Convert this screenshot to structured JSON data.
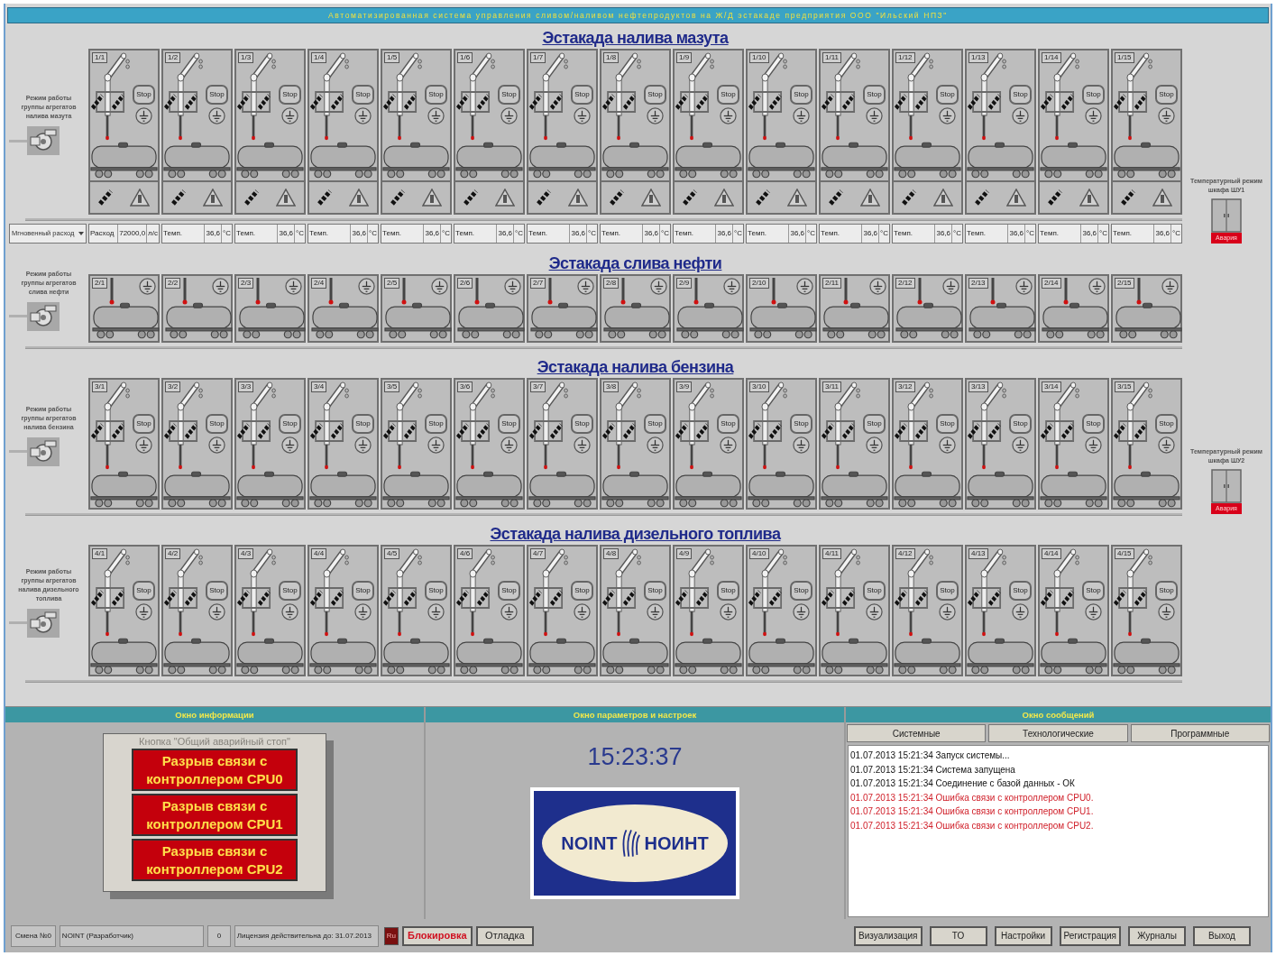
{
  "window": {
    "title": "Автоматизированная система управления сливом/наливом нефтепродуктов на Ж/Д эстакаде предприятия ООО \"Ильский НПЗ\""
  },
  "sections": [
    {
      "title": "Эстакада налива мазута",
      "kind": "loading_valves",
      "group_label": "Режим работы группы агрегатов налива мазута",
      "flow_selector": "Мгновенный расход",
      "bays": [
        {
          "label": "1/1",
          "sign": "Stop"
        },
        {
          "label": "1/2",
          "sign": "Stop"
        },
        {
          "label": "1/3",
          "sign": "Stop"
        },
        {
          "label": "1/4",
          "sign": "Stop"
        },
        {
          "label": "1/5",
          "sign": "Stop"
        },
        {
          "label": "1/6",
          "sign": "Stop"
        },
        {
          "label": "1/7",
          "sign": "Stop"
        },
        {
          "label": "1/8",
          "sign": "Stop"
        },
        {
          "label": "1/9",
          "sign": "Stop"
        },
        {
          "label": "1/10",
          "sign": "Stop"
        },
        {
          "label": "1/11",
          "sign": "Stop"
        },
        {
          "label": "1/12",
          "sign": "Stop"
        },
        {
          "label": "1/13",
          "sign": "Stop"
        },
        {
          "label": "1/14",
          "sign": "Stop"
        },
        {
          "label": "1/15",
          "sign": "Stop"
        }
      ],
      "readings": [
        {
          "name": "Расход",
          "value": "72000,0",
          "unit": "л/с"
        },
        {
          "name": "Темп.",
          "value": "36,6",
          "unit": "°C"
        },
        {
          "name": "Темп.",
          "value": "36,6",
          "unit": "°C"
        },
        {
          "name": "Темп.",
          "value": "36,6",
          "unit": "°C"
        },
        {
          "name": "Темп.",
          "value": "36,6",
          "unit": "°C"
        },
        {
          "name": "Темп.",
          "value": "36,6",
          "unit": "°C"
        },
        {
          "name": "Темп.",
          "value": "36,6",
          "unit": "°C"
        },
        {
          "name": "Темп.",
          "value": "36,6",
          "unit": "°C"
        },
        {
          "name": "Темп.",
          "value": "36,6",
          "unit": "°C"
        },
        {
          "name": "Темп.",
          "value": "36,6",
          "unit": "°C"
        },
        {
          "name": "Темп.",
          "value": "36,6",
          "unit": "°C"
        },
        {
          "name": "Темп.",
          "value": "36,6",
          "unit": "°C"
        },
        {
          "name": "Темп.",
          "value": "36,6",
          "unit": "°C"
        },
        {
          "name": "Темп.",
          "value": "36,6",
          "unit": "°C"
        },
        {
          "name": "Темп.",
          "value": "36,6",
          "unit": "°C"
        }
      ],
      "cabinet": {
        "label": "Температурный режим шкафа ШУ1",
        "alarm": "Авария"
      }
    },
    {
      "title": "Эстакада слива нефти",
      "kind": "drain",
      "group_label": "Режим работы группы агрегатов слива нефти",
      "bays": [
        {
          "label": "2/1"
        },
        {
          "label": "2/2"
        },
        {
          "label": "2/3"
        },
        {
          "label": "2/4"
        },
        {
          "label": "2/5"
        },
        {
          "label": "2/6"
        },
        {
          "label": "2/7"
        },
        {
          "label": "2/8"
        },
        {
          "label": "2/9"
        },
        {
          "label": "2/10"
        },
        {
          "label": "2/11"
        },
        {
          "label": "2/12"
        },
        {
          "label": "2/13"
        },
        {
          "label": "2/14"
        },
        {
          "label": "2/15"
        }
      ]
    },
    {
      "title": "Эстакада налива бензина",
      "kind": "loading",
      "group_label": "Режим работы группы агрегатов налива бензина",
      "bays": [
        {
          "label": "3/1",
          "sign": "Stop"
        },
        {
          "label": "3/2",
          "sign": "Stop"
        },
        {
          "label": "3/3",
          "sign": "Stop"
        },
        {
          "label": "3/4",
          "sign": "Stop"
        },
        {
          "label": "3/5",
          "sign": "Stop"
        },
        {
          "label": "3/6",
          "sign": "Stop"
        },
        {
          "label": "3/7",
          "sign": "Stop"
        },
        {
          "label": "3/8",
          "sign": "Stop"
        },
        {
          "label": "3/9",
          "sign": "Stop"
        },
        {
          "label": "3/10",
          "sign": "Stop"
        },
        {
          "label": "3/11",
          "sign": "Stop"
        },
        {
          "label": "3/12",
          "sign": "Stop"
        },
        {
          "label": "3/13",
          "sign": "Stop"
        },
        {
          "label": "3/14",
          "sign": "Stop"
        },
        {
          "label": "3/15",
          "sign": "Stop"
        }
      ],
      "cabinet": {
        "label": "Температурный режим шкафа ШУ2",
        "alarm": "Авария"
      }
    },
    {
      "title": "Эстакада налива дизельного топлива",
      "kind": "loading",
      "group_label": "Режим работы группы агрегатов налива дизельного топлива",
      "bays": [
        {
          "label": "4/1",
          "sign": "Stop"
        },
        {
          "label": "4/2",
          "sign": "Stop"
        },
        {
          "label": "4/3",
          "sign": "Stop"
        },
        {
          "label": "4/4",
          "sign": "Stop"
        },
        {
          "label": "4/5",
          "sign": "Stop"
        },
        {
          "label": "4/6",
          "sign": "Stop"
        },
        {
          "label": "4/7",
          "sign": "Stop"
        },
        {
          "label": "4/8",
          "sign": "Stop"
        },
        {
          "label": "4/9",
          "sign": "Stop"
        },
        {
          "label": "4/10",
          "sign": "Stop"
        },
        {
          "label": "4/11",
          "sign": "Stop"
        },
        {
          "label": "4/12",
          "sign": "Stop"
        },
        {
          "label": "4/13",
          "sign": "Stop"
        },
        {
          "label": "4/14",
          "sign": "Stop"
        },
        {
          "label": "4/15",
          "sign": "Stop"
        }
      ]
    }
  ],
  "info_panel": {
    "title": "Окно информации",
    "caption": "Кнопка \"Общий аварийный стоп\"",
    "alarms": [
      "Разрыв связи с контроллером CPU0",
      "Разрыв связи с контроллером CPU1",
      "Разрыв связи с контроллером CPU2"
    ]
  },
  "params_panel": {
    "title": "Окно параметров и настроек",
    "clock": "15:23:37",
    "logo": {
      "left": "NOINT",
      "right": "НОИНТ"
    }
  },
  "messages_panel": {
    "title": "Окно сообщений",
    "tabs": [
      {
        "label": "Системные",
        "selected": false
      },
      {
        "label": "Технологические",
        "selected": false
      },
      {
        "label": "Программные",
        "selected": false
      }
    ],
    "messages": [
      {
        "text": "01.07.2013 15:21:34 Запуск системы...",
        "kind": "info"
      },
      {
        "text": "01.07.2013 15:21:34 Система запущена",
        "kind": "info"
      },
      {
        "text": "01.07.2013 15:21:34 Соединение с базой данных - ОК",
        "kind": "info"
      },
      {
        "text": "01.07.2013 15:21:34 Ошибка связи с контроллером CPU0.",
        "kind": "error"
      },
      {
        "text": "01.07.2013 15:21:34 Ошибка связи с контроллером CPU1.",
        "kind": "error"
      },
      {
        "text": "01.07.2013 15:21:34 Ошибка связи с контроллером CPU2.",
        "kind": "error"
      }
    ]
  },
  "status_bar": {
    "shift": "Смена №0",
    "user": "NOINT (Разработчик)",
    "counter": "0",
    "license": "Лицензия действительна до: 31.07.2013",
    "language": "Ru",
    "buttons_left": [
      {
        "label": "Блокировка",
        "kind": "alert"
      },
      {
        "label": "Отладка",
        "kind": "normal"
      }
    ],
    "buttons_right": [
      "Визуализация",
      "ТО",
      "Настройки",
      "Регистрация",
      "Журналы",
      "Выход"
    ]
  }
}
